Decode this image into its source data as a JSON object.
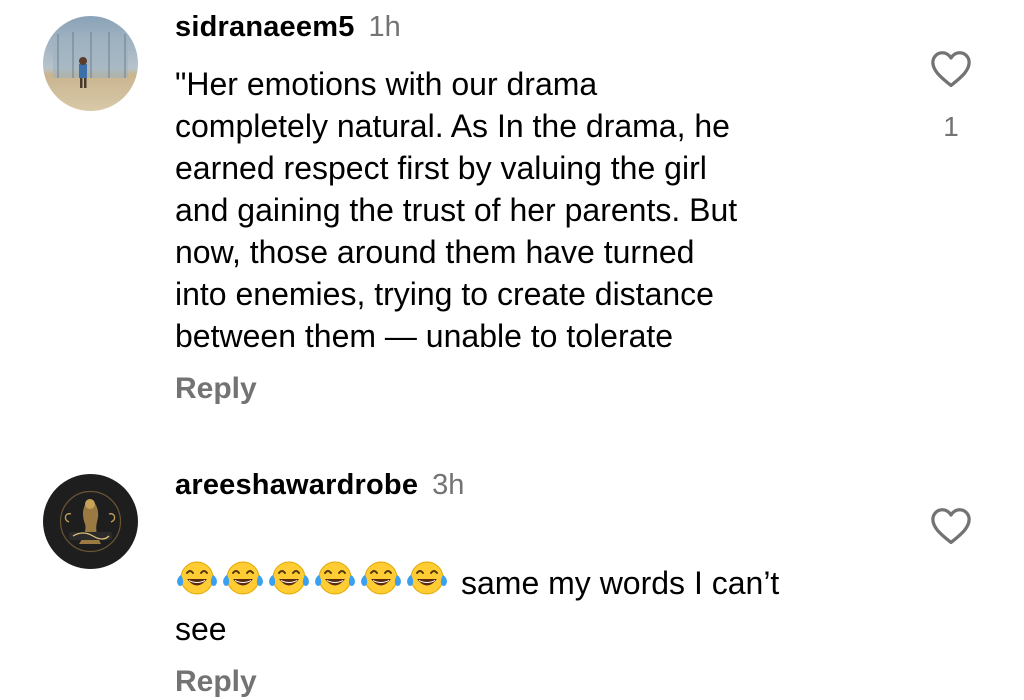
{
  "comments": [
    {
      "username": "sidranaeem5",
      "time": "1h",
      "text": "\"Her emotions  with our drama\ncompletely natural. As In the drama, he\nearned respect first by valuing the girl\nand gaining the trust of her parents. But\nnow, those around them have turned\ninto enemies, trying to create distance\nbetween them — unable to tolerate",
      "reply_label": "Reply",
      "like_count": "1"
    },
    {
      "username": "areeshawardrobe",
      "time": "3h",
      "emoji_count": 6,
      "emoji_name": "face-with-tears-of-joy",
      "text": "same my words I can’t\nsee",
      "reply_label": "Reply",
      "like_count": ""
    }
  ]
}
